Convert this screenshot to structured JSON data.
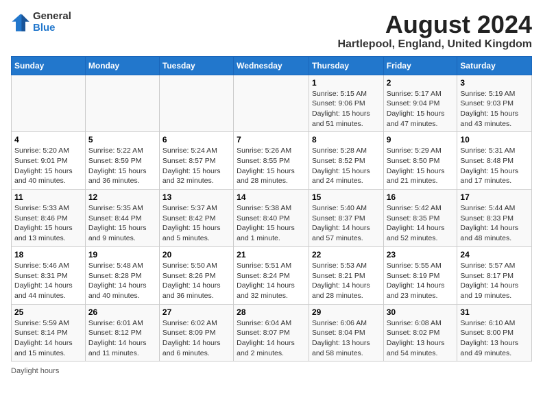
{
  "logo": {
    "general": "General",
    "blue": "Blue"
  },
  "title": "August 2024",
  "location": "Hartlepool, England, United Kingdom",
  "days_of_week": [
    "Sunday",
    "Monday",
    "Tuesday",
    "Wednesday",
    "Thursday",
    "Friday",
    "Saturday"
  ],
  "footer": {
    "daylight_label": "Daylight hours"
  },
  "weeks": [
    [
      {
        "day": "",
        "info": ""
      },
      {
        "day": "",
        "info": ""
      },
      {
        "day": "",
        "info": ""
      },
      {
        "day": "",
        "info": ""
      },
      {
        "day": "1",
        "info": "Sunrise: 5:15 AM\nSunset: 9:06 PM\nDaylight: 15 hours\nand 51 minutes."
      },
      {
        "day": "2",
        "info": "Sunrise: 5:17 AM\nSunset: 9:04 PM\nDaylight: 15 hours\nand 47 minutes."
      },
      {
        "day": "3",
        "info": "Sunrise: 5:19 AM\nSunset: 9:03 PM\nDaylight: 15 hours\nand 43 minutes."
      }
    ],
    [
      {
        "day": "4",
        "info": "Sunrise: 5:20 AM\nSunset: 9:01 PM\nDaylight: 15 hours\nand 40 minutes."
      },
      {
        "day": "5",
        "info": "Sunrise: 5:22 AM\nSunset: 8:59 PM\nDaylight: 15 hours\nand 36 minutes."
      },
      {
        "day": "6",
        "info": "Sunrise: 5:24 AM\nSunset: 8:57 PM\nDaylight: 15 hours\nand 32 minutes."
      },
      {
        "day": "7",
        "info": "Sunrise: 5:26 AM\nSunset: 8:55 PM\nDaylight: 15 hours\nand 28 minutes."
      },
      {
        "day": "8",
        "info": "Sunrise: 5:28 AM\nSunset: 8:52 PM\nDaylight: 15 hours\nand 24 minutes."
      },
      {
        "day": "9",
        "info": "Sunrise: 5:29 AM\nSunset: 8:50 PM\nDaylight: 15 hours\nand 21 minutes."
      },
      {
        "day": "10",
        "info": "Sunrise: 5:31 AM\nSunset: 8:48 PM\nDaylight: 15 hours\nand 17 minutes."
      }
    ],
    [
      {
        "day": "11",
        "info": "Sunrise: 5:33 AM\nSunset: 8:46 PM\nDaylight: 15 hours\nand 13 minutes."
      },
      {
        "day": "12",
        "info": "Sunrise: 5:35 AM\nSunset: 8:44 PM\nDaylight: 15 hours\nand 9 minutes."
      },
      {
        "day": "13",
        "info": "Sunrise: 5:37 AM\nSunset: 8:42 PM\nDaylight: 15 hours\nand 5 minutes."
      },
      {
        "day": "14",
        "info": "Sunrise: 5:38 AM\nSunset: 8:40 PM\nDaylight: 15 hours\nand 1 minute."
      },
      {
        "day": "15",
        "info": "Sunrise: 5:40 AM\nSunset: 8:37 PM\nDaylight: 14 hours\nand 57 minutes."
      },
      {
        "day": "16",
        "info": "Sunrise: 5:42 AM\nSunset: 8:35 PM\nDaylight: 14 hours\nand 52 minutes."
      },
      {
        "day": "17",
        "info": "Sunrise: 5:44 AM\nSunset: 8:33 PM\nDaylight: 14 hours\nand 48 minutes."
      }
    ],
    [
      {
        "day": "18",
        "info": "Sunrise: 5:46 AM\nSunset: 8:31 PM\nDaylight: 14 hours\nand 44 minutes."
      },
      {
        "day": "19",
        "info": "Sunrise: 5:48 AM\nSunset: 8:28 PM\nDaylight: 14 hours\nand 40 minutes."
      },
      {
        "day": "20",
        "info": "Sunrise: 5:50 AM\nSunset: 8:26 PM\nDaylight: 14 hours\nand 36 minutes."
      },
      {
        "day": "21",
        "info": "Sunrise: 5:51 AM\nSunset: 8:24 PM\nDaylight: 14 hours\nand 32 minutes."
      },
      {
        "day": "22",
        "info": "Sunrise: 5:53 AM\nSunset: 8:21 PM\nDaylight: 14 hours\nand 28 minutes."
      },
      {
        "day": "23",
        "info": "Sunrise: 5:55 AM\nSunset: 8:19 PM\nDaylight: 14 hours\nand 23 minutes."
      },
      {
        "day": "24",
        "info": "Sunrise: 5:57 AM\nSunset: 8:17 PM\nDaylight: 14 hours\nand 19 minutes."
      }
    ],
    [
      {
        "day": "25",
        "info": "Sunrise: 5:59 AM\nSunset: 8:14 PM\nDaylight: 14 hours\nand 15 minutes."
      },
      {
        "day": "26",
        "info": "Sunrise: 6:01 AM\nSunset: 8:12 PM\nDaylight: 14 hours\nand 11 minutes."
      },
      {
        "day": "27",
        "info": "Sunrise: 6:02 AM\nSunset: 8:09 PM\nDaylight: 14 hours\nand 6 minutes."
      },
      {
        "day": "28",
        "info": "Sunrise: 6:04 AM\nSunset: 8:07 PM\nDaylight: 14 hours\nand 2 minutes."
      },
      {
        "day": "29",
        "info": "Sunrise: 6:06 AM\nSunset: 8:04 PM\nDaylight: 13 hours\nand 58 minutes."
      },
      {
        "day": "30",
        "info": "Sunrise: 6:08 AM\nSunset: 8:02 PM\nDaylight: 13 hours\nand 54 minutes."
      },
      {
        "day": "31",
        "info": "Sunrise: 6:10 AM\nSunset: 8:00 PM\nDaylight: 13 hours\nand 49 minutes."
      }
    ]
  ]
}
